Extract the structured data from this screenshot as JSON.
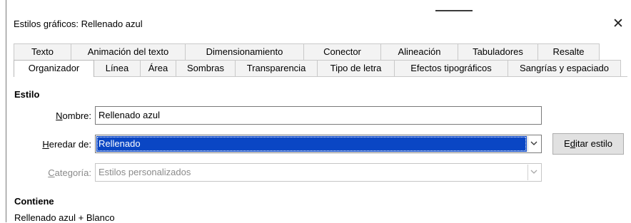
{
  "dialog": {
    "title": "Estilos gráficos: Rellenado azul",
    "close_glyph": "✕"
  },
  "tabs_row1": [
    {
      "label": "Texto"
    },
    {
      "label": "Animación del texto"
    },
    {
      "label": "Dimensionamiento"
    },
    {
      "label": "Conector"
    },
    {
      "label": "Alineación"
    },
    {
      "label": "Tabuladores"
    },
    {
      "label": "Resalte"
    }
  ],
  "tabs_row2": [
    {
      "label": "Organizador",
      "active": true
    },
    {
      "label": "Línea"
    },
    {
      "label": "Área"
    },
    {
      "label": "Sombras"
    },
    {
      "label": "Transparencia"
    },
    {
      "label": "Tipo de letra"
    },
    {
      "label": "Efectos tipográficos"
    },
    {
      "label": "Sangrías y espaciado"
    }
  ],
  "style_section": {
    "heading": "Estilo",
    "name_label_mnemonic": "N",
    "name_label_rest": "ombre:",
    "name_value": "Rellenado azul",
    "inherit_label_mnemonic": "H",
    "inherit_label_rest": "eredar de:",
    "inherit_value": "Rellenado",
    "edit_button_mnemonic": "d",
    "edit_button_pre": "E",
    "edit_button_rest": "itar estilo",
    "category_label_mnemonic": "C",
    "category_label_rest": "ategoría:",
    "category_value": "Estilos personalizados"
  },
  "contains_section": {
    "heading": "Contiene",
    "text": "Rellenado azul + Blanco"
  },
  "colors": {
    "selection": "#0a46c4",
    "disabled_text": "#8a8a8a"
  }
}
